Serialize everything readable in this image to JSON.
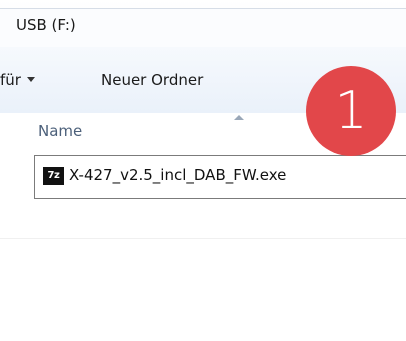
{
  "address": {
    "path": "USB (F:)"
  },
  "toolbar": {
    "menu_label": "für",
    "new_folder_label": "Neuer Ordner"
  },
  "file_list": {
    "header_name": "Name",
    "items": [
      {
        "icon": "7z-icon",
        "icon_text": "7z",
        "name": "X-427_v2.5_incl_DAB_FW.exe"
      }
    ]
  },
  "overlay": {
    "step_number": "1",
    "badge_color": "#e2474a"
  }
}
